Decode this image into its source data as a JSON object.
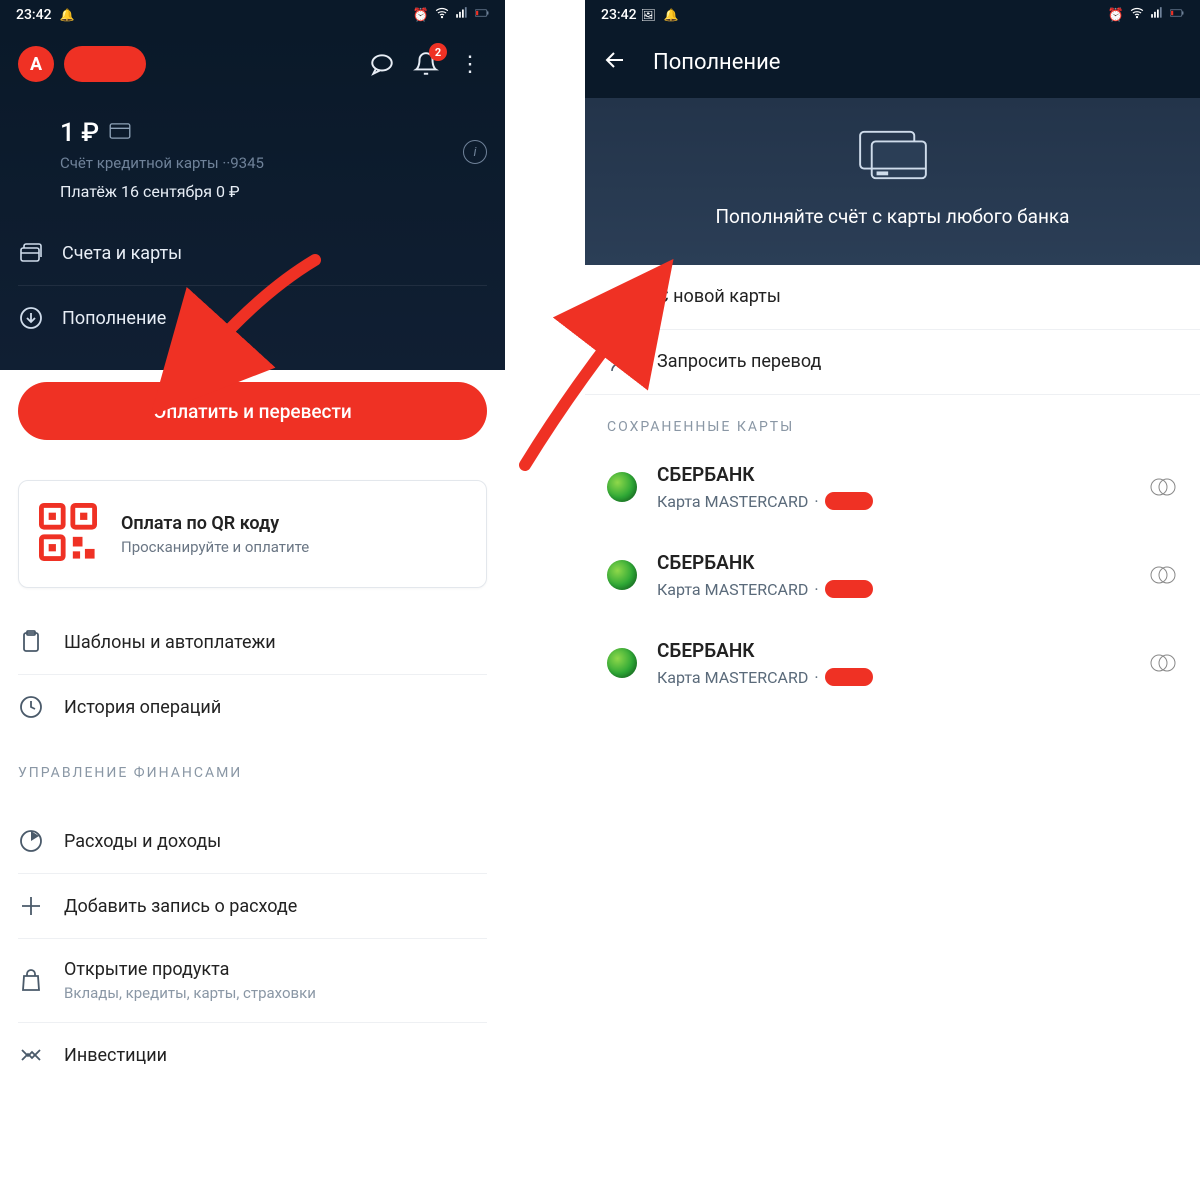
{
  "status": {
    "time": "23:42",
    "battery_low": true
  },
  "left": {
    "header": {
      "logo_letter": "A",
      "notif_badge": "2"
    },
    "balance": {
      "amount": "1 ₽",
      "account_label": "Счёт кредитной карты ··9345",
      "payment_line": "Платёж 16 сентября  0 ₽"
    },
    "nav": {
      "accounts": "Счета и карты",
      "topup": "Пополнение"
    },
    "pay_button": "Оплатить и перевести",
    "qr": {
      "title": "Оплата по QR коду",
      "subtitle": "Просканируйте и оплатите"
    },
    "items": {
      "templates": "Шаблоны и автоплатежи",
      "history": "История операций"
    },
    "section_finance": "УПРАВЛЕНИЕ ФИНАНСАМИ",
    "finance": {
      "expenses": "Расходы и доходы",
      "add_expense": "Добавить запись о расходе",
      "open_product": "Открытие продукта",
      "open_product_sub": "Вклады, кредиты, карты, страховки",
      "invest": "Инвестиции"
    }
  },
  "right": {
    "title": "Пополнение",
    "hero_text": "Пополняйте счёт с карты любого банка",
    "new_card": "С новой карты",
    "request_transfer": "Запросить перевод",
    "saved_header": "СОХРАНЕННЫЕ КАРТЫ",
    "saved": [
      {
        "bank": "СБЕРБАНК",
        "card_type": "Карта MASTERCARD"
      },
      {
        "bank": "СБЕРБАНК",
        "card_type": "Карта MASTERCARD"
      },
      {
        "bank": "СБЕРБАНК",
        "card_type": "Карта MASTERCARD"
      }
    ]
  }
}
